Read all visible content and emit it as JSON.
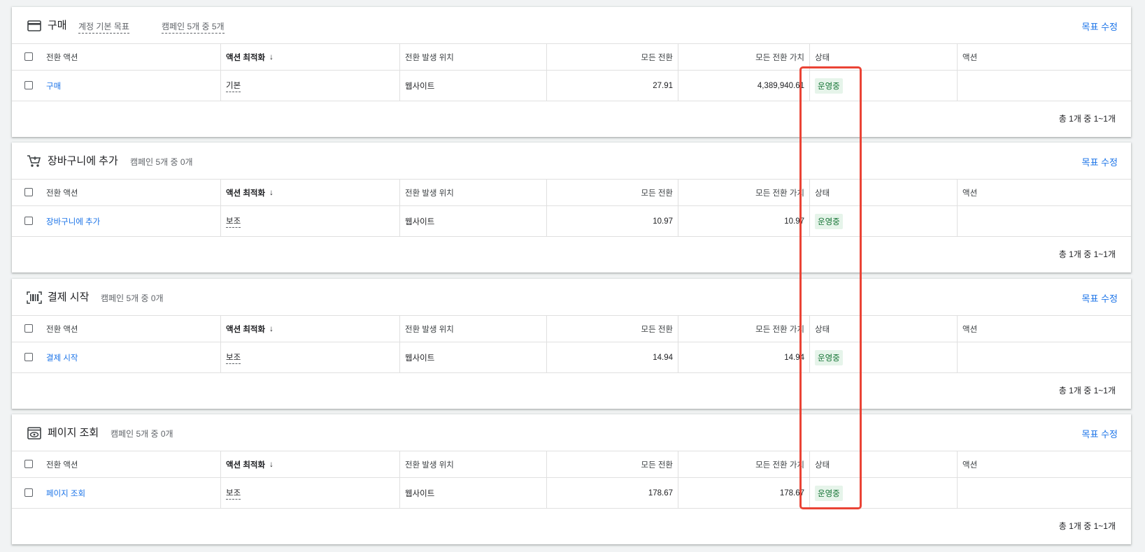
{
  "columns": {
    "action": "전환 액션",
    "optimization": "액션 최적화",
    "source": "전환 발생 위치",
    "all_conversions": "모든 전환",
    "all_conversion_value": "모든 전환 가치",
    "status": "상태",
    "actions": "액션"
  },
  "goals": [
    {
      "title": "구매",
      "sub1": "계정 기본 목표",
      "sub2": "캠페인 5개 중 5개",
      "edit_label": "목표 수정",
      "icon": "credit-card-icon",
      "row": {
        "action": "구매",
        "optimization": "기본",
        "source": "웹사이트",
        "all_conversions": "27.91",
        "all_conversion_value": "4,389,940.61",
        "status": "운영중"
      },
      "pager": "총 1개 중 1~1개"
    },
    {
      "title": "장바구니에 추가",
      "sub1": "캠페인 5개 중 0개",
      "edit_label": "목표 수정",
      "icon": "shopping-cart-icon",
      "row": {
        "action": "장바구니에 추가",
        "optimization": "보조",
        "source": "웹사이트",
        "all_conversions": "10.97",
        "all_conversion_value": "10.97",
        "status": "운영중"
      },
      "pager": "총 1개 중 1~1개"
    },
    {
      "title": "결제 시작",
      "sub1": "캠페인 5개 중 0개",
      "edit_label": "목표 수정",
      "icon": "barcode-icon",
      "row": {
        "action": "결제 시작",
        "optimization": "보조",
        "source": "웹사이트",
        "all_conversions": "14.94",
        "all_conversion_value": "14.94",
        "status": "운영중"
      },
      "pager": "총 1개 중 1~1개"
    },
    {
      "title": "페이지 조회",
      "sub1": "캠페인 5개 중 0개",
      "edit_label": "목표 수정",
      "icon": "page-view-icon",
      "row": {
        "action": "페이지 조회",
        "optimization": "보조",
        "source": "웹사이트",
        "all_conversions": "178.67",
        "all_conversion_value": "178.67",
        "status": "운영중"
      },
      "pager": "총 1개 중 1~1개"
    }
  ],
  "colors": {
    "link": "#1a73e8",
    "status_bg": "#e6f4ea",
    "status_text": "#137333",
    "highlight": "#ea4335"
  }
}
